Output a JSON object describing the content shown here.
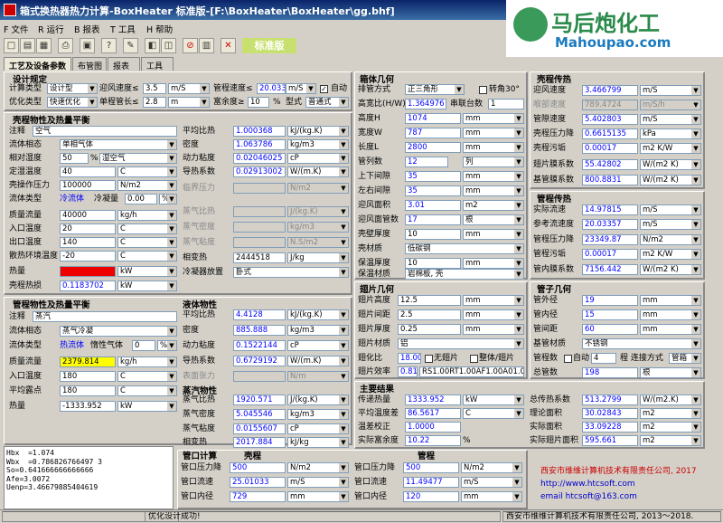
{
  "app": {
    "title": "箱式换热器热力计算-BoxHeater  标准版-[F:\\BoxHeater\\BoxHeater\\gg.bhf]"
  },
  "brand": {
    "name": "马后炮化工",
    "site": "Mahoupao.com"
  },
  "menu": [
    "F 文件",
    "R 运行",
    "B 报表",
    "T 工具",
    "H 帮助"
  ],
  "toolbar": {
    "status_label": "标准版",
    "icons": [
      "new-file-icon",
      "open-icon",
      "save-icon",
      "print-icon",
      "calc-icon",
      "help-icon",
      "tool-icon",
      "chart-icon",
      "image-icon",
      "stop-icon",
      "save2-icon",
      "exit-icon"
    ]
  },
  "tabs": [
    "工艺及设备参数",
    "布管图",
    "报表",
    "工具"
  ],
  "design": {
    "title": "设计规定",
    "calc_type_label": "计算类型",
    "calc_type": "设计型",
    "vel_limit_label": "迎风速度≤",
    "vel_limit": "3.5",
    "vel_unit": "m/S",
    "tube_vel_label": "管程速度≤",
    "tube_vel": "20.0335",
    "tube_vel_unit": "m/S",
    "auto_label": "自动",
    "opt_label": "优化类型",
    "opt_type": "快速优化",
    "tube_len_label": "单程管长≤",
    "tube_len": "2.8",
    "tube_len_unit": "m",
    "margin_label": "富余度≥",
    "margin": "10",
    "margin_unit": "%",
    "form_label": "型式",
    "form": "普通式"
  },
  "shell_side": {
    "title": "壳程物性及热量平衡",
    "note_label": "注释",
    "note": "空气",
    "phase_label": "流体相态",
    "phase": "单相气体",
    "humidity_label": "相对湿度",
    "humidity": "50",
    "humidity_unit": "%",
    "humidity_type": "湿空气",
    "dewpoint_label": "定湿温度",
    "dewpoint": "40",
    "dewpoint_unit": "C",
    "pressure_label": "壳操作压力",
    "pressure": "100000",
    "pressure_unit": "N/m2",
    "fluid_type_label": "流体类型",
    "fluid_type": "冷流体",
    "cond_label": "冷凝量",
    "cond": "0.00",
    "cond_unit": "%",
    "mass_label": "质量流量",
    "mass": "40000",
    "mass_unit": "kg/h",
    "tin_label": "入口温度",
    "tin": "20",
    "tin_unit": "C",
    "tout_label": "出口温度",
    "tout": "140",
    "tout_unit": "C",
    "ambient_label": "散热环境温度",
    "ambient": "-20",
    "ambient_unit": "C",
    "heat_label": "热量",
    "heat": "1333.334",
    "heat_unit": "kW",
    "loss_label": "壳程热损",
    "loss": "0.1183702",
    "loss_unit": "kW"
  },
  "shell_props": {
    "cp_label": "平均比热",
    "cp": "1.000368",
    "cp_unit": "kJ/(kg.K)",
    "rho_label": "密度",
    "rho": "1.063786",
    "rho_unit": "kg/m3",
    "mu_label": "动力粘度",
    "mu": "0.02046025",
    "mu_unit": "cP",
    "k_label": "导热系数",
    "k": "0.02913002",
    "k_unit": "W/(m.K)",
    "crit_label": "临界压力",
    "crit_unit": "N/m2",
    "vcp_label": "蒸气比热",
    "vcp_unit": "J/(kg.K)",
    "vrho_label": "蒸气密度",
    "vrho_unit": "kg/m3",
    "vmu_label": "蒸气粘度",
    "vmu_unit": "N.S/m2",
    "latent_label": "相变热",
    "latent": "2444518",
    "latent_unit": "J/kg",
    "place_label": "冷凝器放置",
    "place": "卧式"
  },
  "tube_side": {
    "title": "管程物性及热量平衡",
    "note_label": "注释",
    "note": "蒸汽",
    "phase_label": "流体相态",
    "phase": "蒸气冷凝",
    "fluid_type_label": "流体类型",
    "fluid_type": "热流体",
    "inert_label": "惰性气体",
    "inert": "0",
    "inert_unit": "%",
    "mass_label": "质量流量",
    "mass": "2379.814",
    "mass_unit": "kg/h",
    "tin_label": "入口温度",
    "tin": "180",
    "tin_unit": "C",
    "dew_label": "平均露点",
    "dew": "180",
    "dew_unit": "C",
    "heat_label": "热量",
    "heat": "-1333.952",
    "heat_unit": "kW"
  },
  "liquid": {
    "title": "液体物性",
    "cp_label": "平均比热",
    "cp": "4.4128",
    "cp_unit": "kJ/(kg.K)",
    "rho_label": "密度",
    "rho": "885.888",
    "rho_unit": "kg/m3",
    "mu_label": "动力粘度",
    "mu": "0.1522144",
    "mu_unit": "cP",
    "k_label": "导热系数",
    "k": "0.6729192",
    "k_unit": "W/(m.K)",
    "st_label": "表面张力",
    "st_unit": "N/m"
  },
  "vapor": {
    "title": "蒸汽物性",
    "cp_label": "蒸气比热",
    "cp": "1920.571",
    "cp_unit": "J/(kg.K)",
    "rho_label": "蒸气密度",
    "rho": "5.045546",
    "rho_unit": "kg/m3",
    "mu_label": "蒸气粘度",
    "mu": "0.0155607",
    "mu_unit": "cP",
    "latent_label": "相变热",
    "latent": "2017.884",
    "latent_unit": "kJ/kg"
  },
  "console": "Hbx  =1.074\nWbx  =0.786826766497 3\nSo=0.641666666666666\nAfe=3.0072\nUenp=3.46679885404619",
  "nozzle": {
    "title": "管口计算",
    "shell": "壳程",
    "tube": "管程",
    "dp_label": "管口压力降",
    "v_label": "管口流速",
    "d_label": "管口内径",
    "s_dp": "500",
    "s_dp_unit": "N/m2",
    "s_v": "25.01033",
    "s_v_unit": "m/S",
    "s_d": "729",
    "s_d_unit": "mm",
    "t_dp": "500",
    "t_dp_unit": "N/m2",
    "t_v": "11.49477",
    "t_v_unit": "m/S",
    "t_d": "120",
    "t_d_unit": "mm"
  },
  "box": {
    "title": "箱体几何",
    "arr_label": "排管方式",
    "arr": "正三角形",
    "rot_label": "转角30°",
    "hw_label": "高宽比(H/W)",
    "hw": "1.364976",
    "series_label": "串联台数",
    "series": "1",
    "h_label": "高度H",
    "h": "1074",
    "h_unit": "mm",
    "w_label": "宽度W",
    "w": "787",
    "w_unit": "mm",
    "l_label": "长度L",
    "l": "2800",
    "l_unit": "mm",
    "cols_label": "管列数",
    "cols": "12",
    "cols_unit": "列",
    "vgap_label": "上下间隙",
    "vgap": "35",
    "vgap_unit": "mm",
    "hgap_label": "左右间隙",
    "hgap": "35",
    "hgap_unit": "mm",
    "area_label": "迎风面积",
    "area": "3.01",
    "area_unit": "m2",
    "rows_label": "迎风面管数",
    "rows": "17",
    "rows_unit": "根",
    "thk_label": "壳壁厚度",
    "thk": "10",
    "thk_unit": "mm",
    "mat_label": "壳材质",
    "mat": "低碳钢",
    "ins_label": "保温厚度",
    "ins": "10",
    "ins_unit": "mm",
    "insmat_label": "保温材质",
    "insmat": "岩棉板, 壳"
  },
  "fin": {
    "title": "翅片几何",
    "h_label": "翅片高度",
    "h": "12.5",
    "h_unit": "mm",
    "p_label": "翅片间距",
    "p": "2.5",
    "p_unit": "mm",
    "t_label": "翅片厚度",
    "t": "0.25",
    "t_unit": "mm",
    "mat_label": "翅片材质",
    "mat": "铝",
    "ratio_label": "翅化比",
    "ratio": "18.00",
    "none_label": "无翅片",
    "whole_label": "整体/翅片",
    "eff_label": "翅片效率",
    "eff": "0.81",
    "code": "RS1.00RT1.00AF1.00A01.00"
  },
  "results": {
    "title": "主要结果",
    "q_label": "传递热量",
    "q": "1333.952",
    "q_unit": "kW",
    "lmtd_label": "平均温度差",
    "lmtd": "86.5617",
    "lmtd_unit": "C",
    "corr_label": "温差校正",
    "corr": "1.0000",
    "margin_label": "实际富余度",
    "margin": "10.22",
    "margin_unit": "%",
    "U_label": "总传热系数",
    "U": "513.2799",
    "U_unit": "W/(m2.K)",
    "A_label": "理论面积",
    "A": "30.02843",
    "A_unit": "m2",
    "Ar_label": "实际面积",
    "Ar": "33.09228",
    "Ar_unit": "m2",
    "Af_label": "实际翅片面积",
    "Af": "595.661",
    "Af_unit": "m2"
  },
  "shell_ht": {
    "title": "壳程传热",
    "v_label": "迎风速度",
    "v": "3.466799",
    "v_unit": "m/S",
    "lim_label": "喉部速度",
    "lim": "789.4724",
    "lim_unit": "m/S/h",
    "vv_label": "管隙速度",
    "vv": "5.402803",
    "vv_unit": "m/S",
    "dp_label": "壳程压力降",
    "dp": "0.6615135",
    "dp_unit": "kPa",
    "f_label": "壳程污垢",
    "f": "0.00017",
    "f_unit": "m2 K/W",
    "hfin_label": "翅片膜系数",
    "hfin": "55.42802",
    "hfin_unit": "W/(m2 K)",
    "hb_label": "基管膜系数",
    "hb": "800.8831",
    "hb_unit": "W/(m2 K)"
  },
  "tube_ht": {
    "title": "管程传热",
    "v_label": "实际流速",
    "v": "14.97815",
    "v_unit": "m/S",
    "rv_label": "参考流速度",
    "rv": "20.03357",
    "rv_unit": "m/S",
    "dp_label": "管程压力降",
    "dp": "23349.87",
    "dp_unit": "N/m2",
    "f_label": "管程污垢",
    "f": "0.00017",
    "f_unit": "m2 K/W",
    "h_label": "管内膜系数",
    "h": "7156.442",
    "h_unit": "W/(m2 K)"
  },
  "tube_geo": {
    "title": "管子几何",
    "od_label": "管外径",
    "od": "19",
    "od_unit": "mm",
    "id_label": "管内径",
    "id": "15",
    "id_unit": "mm",
    "pitch_label": "管间距",
    "pitch": "60",
    "pitch_unit": "mm",
    "mat_label": "基管材质",
    "mat": "不锈钢",
    "pass_label": "管程数",
    "auto_label": "自动",
    "pass": "4",
    "conn_label": "程 连接方式",
    "conn": "管箱",
    "n_label": "总管数",
    "n": "198",
    "n_unit": "根"
  },
  "company": {
    "name": "西安市维维计算机技术有限责任公司, 2017",
    "url": "http://www.htcsoft.com",
    "email": "email htcsoft@163.com"
  },
  "status": {
    "left": "优化设计成功!",
    "right": "西安市维维计算机技术有限责任公司, 2013～2018."
  }
}
